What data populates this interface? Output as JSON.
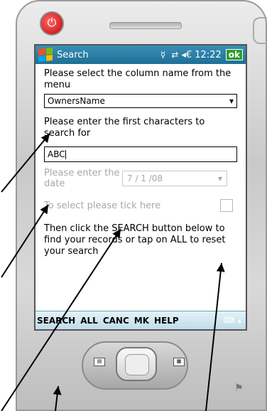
{
  "titlebar": {
    "title": "Search",
    "time": "◂€ 12:22",
    "ok_label": "ok"
  },
  "form": {
    "column_prompt": "Please select the column name from the menu",
    "column_selected": "OwnersName",
    "chars_prompt": "Please enter the first characters to search for",
    "search_value": "ABC",
    "date_label": "Please enter the date",
    "date_value": "7 / 1 /08",
    "tick_label": "To select please tick here",
    "instructions": "Then click the SEARCH button below to find your records or tap on ALL to reset your search"
  },
  "softkeys": [
    "SEARCH",
    "ALL",
    "CANC",
    "MK",
    "HELP"
  ],
  "icons": {
    "power": "power-icon",
    "signal": "signal-icon",
    "sync": "sync-icon",
    "speaker": "volume-icon",
    "keyboard": "keyboard-icon"
  },
  "colors": {
    "titlebar": "#1e6f95",
    "ok_button": "#2d9c2d",
    "softbar": "#bfdcea"
  }
}
